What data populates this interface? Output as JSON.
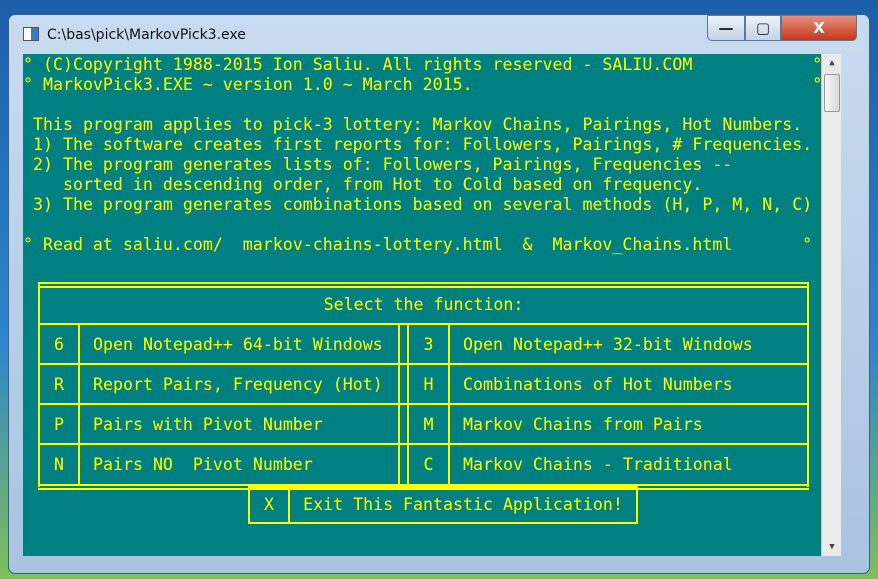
{
  "window": {
    "title": "C:\\bas\\pick\\MarkovPick3.exe",
    "minimize": "—",
    "maximize": "▢",
    "close": "X"
  },
  "console": {
    "lines": [
      "° (C)Copyright 1988-2015 Ion Saliu. All rights reserved - SALIU.COM            °",
      "° MarkovPick3.EXE ~ version 1.0 ~ March 2015.                                  °",
      "",
      " This program applies to pick-3 lottery: Markov Chains, Pairings, Hot Numbers.",
      " 1) The software creates first reports for: Followers, Pairings, # Frequencies.",
      " 2) The program generates lists of: Followers, Pairings, Frequencies --",
      "    sorted in descending order, from Hot to Cold based on frequency.",
      " 3) The program generates combinations based on several methods (H, P, M, N, C)",
      "",
      "° Read at saliu.com/  markov-chains-lottery.html  &  Markov_Chains.html       °"
    ]
  },
  "menu": {
    "header": "Select the function:",
    "rows": [
      {
        "lk": "6",
        "ll": "Open Notepad++ 64-bit Windows",
        "rk": "3",
        "rl": "Open Notepad++ 32-bit Windows"
      },
      {
        "lk": "R",
        "ll": "Report Pairs, Frequency (Hot)",
        "rk": "H",
        "rl": "Combinations of Hot Numbers"
      },
      {
        "lk": "P",
        "ll": "Pairs with Pivot Number",
        "rk": "M",
        "rl": "Markov Chains from Pairs"
      },
      {
        "lk": "N",
        "ll": "Pairs NO  Pivot Number",
        "rk": "C",
        "rl": "Markov Chains - Traditional"
      }
    ],
    "exit": {
      "key": "X",
      "label": "Exit This Fantastic Application!"
    }
  },
  "colors": {
    "background": "#008080",
    "text": "#ffff00"
  }
}
